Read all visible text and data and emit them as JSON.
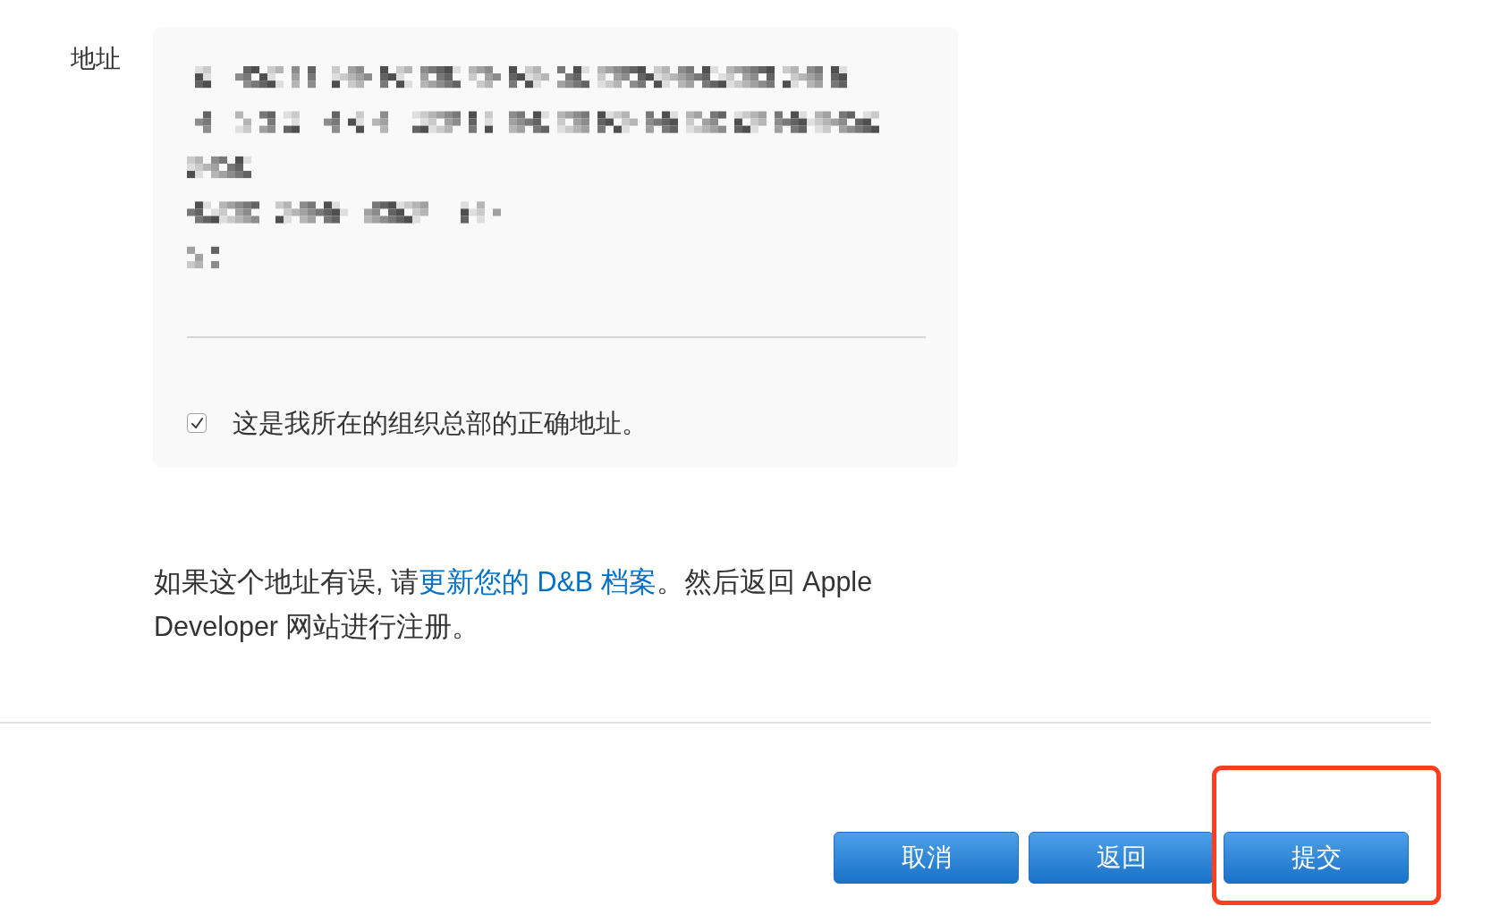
{
  "address": {
    "label": "地址",
    "confirm": {
      "checked": true,
      "label": "这是我所在的组织总部的正确地址。"
    }
  },
  "notice": {
    "before": "如果这个地址有误, 请",
    "link": "更新您的 D&B 档案",
    "after": "。然后返回 Apple Developer 网站进行注册。"
  },
  "buttons": [
    {
      "label": "取消",
      "highlighted": false
    },
    {
      "label": "返回",
      "highlighted": false
    },
    {
      "label": "提交",
      "highlighted": true
    }
  ]
}
